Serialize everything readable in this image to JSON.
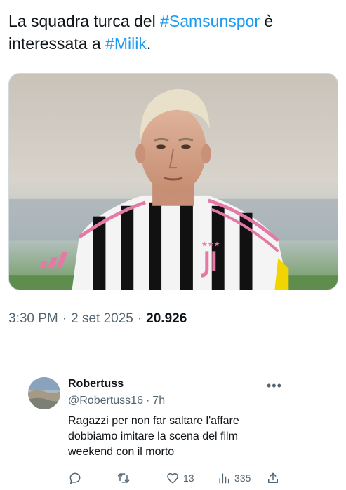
{
  "tweet": {
    "text_before": "La squadra turca del ",
    "hashtag1": "#Samsunspor",
    "text_middle": " è interessata a ",
    "hashtag2": "#Milik",
    "text_after": ".",
    "time": "3:30 PM",
    "separator": "·",
    "date": "2 set 2025",
    "views": "20.926"
  },
  "reply": {
    "author": "Robertuss",
    "handle": "@Robertuss16",
    "separator": "·",
    "age": "7h",
    "more_glyph": "•••",
    "text": "Ragazzi per non far saltare l'affare dobbiamo imitare la scena del film weekend con il morto",
    "actions": {
      "reply_icon": "comment-icon",
      "retweet_icon": "retweet-icon",
      "like_icon": "heart-icon",
      "like_count": "13",
      "views_icon": "analytics-icon",
      "views_count": "335",
      "share_icon": "share-icon"
    }
  },
  "colors": {
    "link": "#1d9bf0",
    "text": "#0f1419",
    "secondary": "#536471",
    "border": "#cfd9de"
  }
}
